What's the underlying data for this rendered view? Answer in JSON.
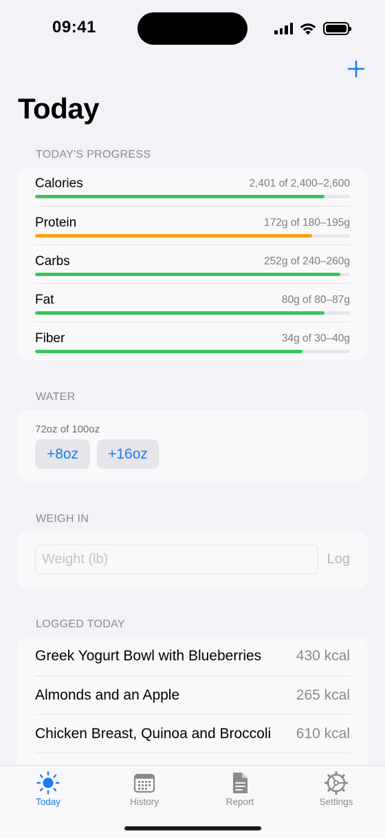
{
  "status_bar": {
    "time": "09:41"
  },
  "header": {
    "title": "Today",
    "add_icon": "plus-icon"
  },
  "progress": {
    "section_title": "TODAY'S PROGRESS",
    "items": [
      {
        "label": "Calories",
        "value": "2,401 of 2,400–2,600",
        "fraction": 0.92,
        "color": "#34c759"
      },
      {
        "label": "Protein",
        "value": "172g of 180–195g",
        "fraction": 0.88,
        "color": "#ff9f0a"
      },
      {
        "label": "Carbs",
        "value": "252g of 240–260g",
        "fraction": 0.97,
        "color": "#34c759"
      },
      {
        "label": "Fat",
        "value": "80g of 80–87g",
        "fraction": 0.92,
        "color": "#34c759"
      },
      {
        "label": "Fiber",
        "value": "34g of 30–40g",
        "fraction": 0.85,
        "color": "#34c759"
      }
    ]
  },
  "water": {
    "section_title": "WATER",
    "status": "72oz of 100oz",
    "buttons": [
      "+8oz",
      "+16oz"
    ]
  },
  "weigh_in": {
    "section_title": "WEIGH IN",
    "placeholder": "Weight (lb)",
    "log_label": "Log"
  },
  "logged": {
    "section_title": "LOGGED TODAY",
    "items": [
      {
        "name": "Greek Yogurt Bowl with Blueberries",
        "kcal": "430 kcal"
      },
      {
        "name": "Almonds and an Apple",
        "kcal": "265 kcal"
      },
      {
        "name": "Chicken Breast, Quinoa and Broccoli",
        "kcal": "610 kcal"
      }
    ]
  },
  "tab_bar": {
    "active_color": "#1a7cf5",
    "tabs": [
      {
        "label": "Today",
        "icon": "sun-icon",
        "active": true
      },
      {
        "label": "History",
        "icon": "calendar-icon",
        "active": false
      },
      {
        "label": "Report",
        "icon": "document-icon",
        "active": false
      },
      {
        "label": "Settings",
        "icon": "gear-icon",
        "active": false
      }
    ]
  }
}
